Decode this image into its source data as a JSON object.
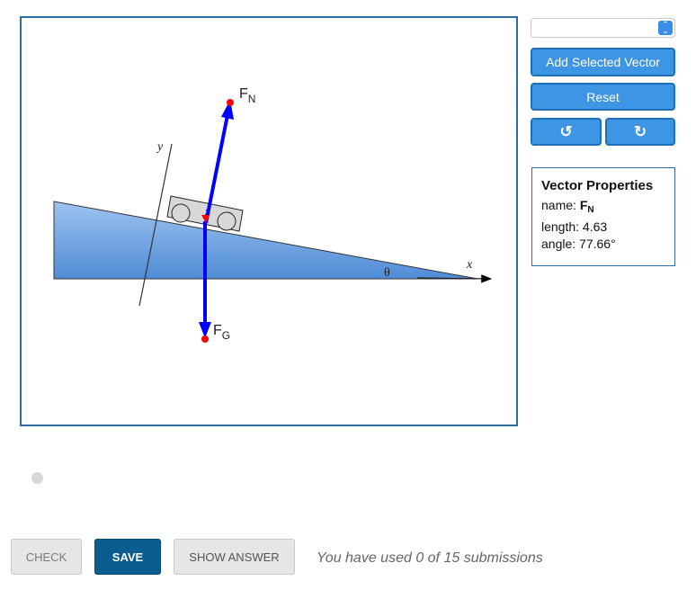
{
  "diagram": {
    "axis_y_label": "y",
    "axis_x_label": "x",
    "angle_label": "θ",
    "vectors": [
      {
        "name": "F",
        "subscript": "N",
        "color": "#0000ff"
      },
      {
        "name": "F",
        "subscript": "G",
        "color": "#0000ff"
      }
    ],
    "incline_color": "#5b93da",
    "endpoint_color": "#ff0000"
  },
  "controls": {
    "select_value": "",
    "add_vector_label": "Add Selected Vector",
    "reset_label": "Reset",
    "undo_icon": "↺",
    "redo_icon": "↻"
  },
  "properties": {
    "title": "Vector Properties",
    "name_label": "name:",
    "name_value": "F",
    "name_sub": "N",
    "length_text": "length: 4.63",
    "angle_text": "angle: 77.66°"
  },
  "actions": {
    "check_label": "CHECK",
    "save_label": "SAVE",
    "show_answer_label": "SHOW ANSWER",
    "submissions_text": "You have used 0 of 15 submissions"
  }
}
